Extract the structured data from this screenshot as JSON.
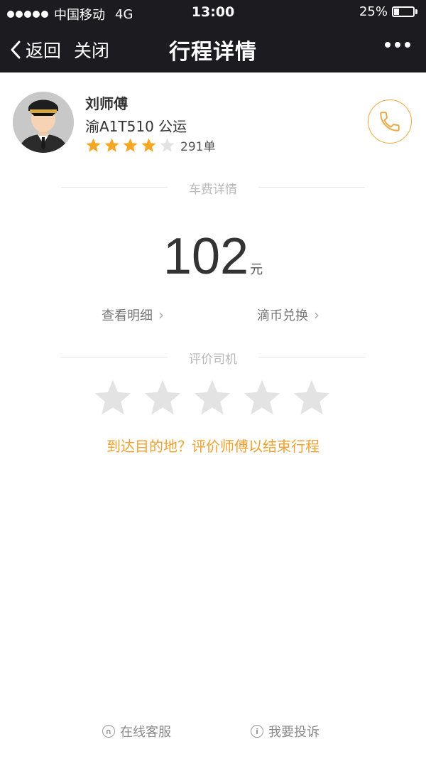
{
  "status_bar": {
    "carrier": "中国移动",
    "network": "4G",
    "time": "13:00",
    "battery": "25%",
    "battery_level": 0.25
  },
  "nav": {
    "back_label": "返回",
    "close_label": "关闭",
    "title": "行程详情"
  },
  "driver": {
    "name": "刘师傅",
    "plate": "渝A1T510 公运",
    "rating": 4,
    "rating_max": 5,
    "orders": "291单"
  },
  "fare_section": {
    "title": "车费详情",
    "amount": "102",
    "unit": "元",
    "detail_link": "查看明细",
    "coin_link": "滴币兑换"
  },
  "review_section": {
    "title": "评价司机",
    "stars": 5,
    "prompt": "到达目的地？评价师傅以结束行程"
  },
  "footer": {
    "service_label": "在线客服",
    "complaint_label": "我要投诉"
  },
  "colors": {
    "accent": "#f0a02e",
    "topbar": "#1c1c20",
    "star_filled": "#f5a623",
    "star_empty": "#e3e3e3"
  }
}
